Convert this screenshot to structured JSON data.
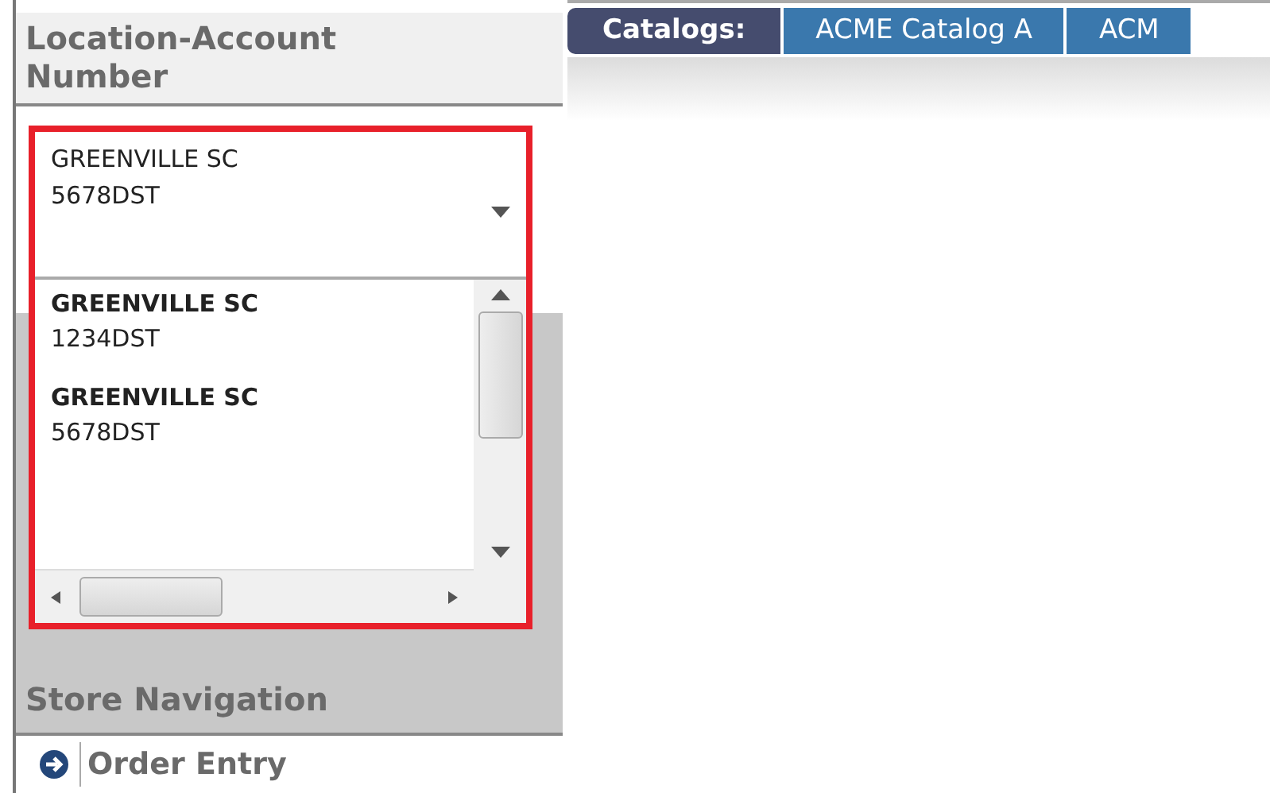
{
  "location_panel": {
    "title": "Location-Account Number",
    "dropdown": {
      "highlighted": true,
      "expanded": true,
      "selected_value": {
        "name": "GREENVILLE SC",
        "account": "5678DST"
      },
      "options": [
        {
          "name": "GREENVILLE SC",
          "account": "1234DST",
          "selected": false
        },
        {
          "name": "GREENVILLE SC",
          "account": "5678DST",
          "selected": false
        }
      ]
    }
  },
  "store_navigation": {
    "title": "Store Navigation",
    "items": [
      {
        "label": "Order Entry"
      }
    ]
  },
  "catalog_bar": {
    "label": "Catalogs:",
    "tabs": [
      {
        "label": "ACME Catalog A",
        "selected": false
      },
      {
        "label": "ACM",
        "selected": false
      }
    ]
  }
}
